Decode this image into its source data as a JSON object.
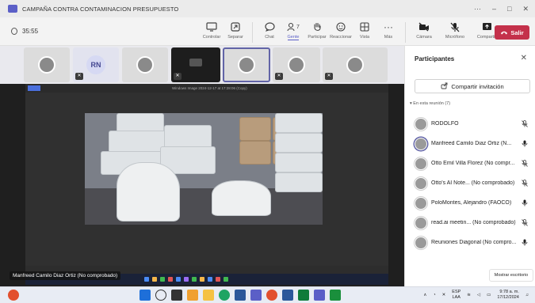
{
  "window": {
    "title": "CAMPAÑA CONTRA CONTAMINACION PRESUPUESTO",
    "controls": [
      "···",
      "–",
      "□",
      "✕"
    ]
  },
  "meeting": {
    "elapsed": "35:55",
    "tools": [
      {
        "label": "Controlar",
        "icon": "control-icon"
      },
      {
        "label": "Separar",
        "icon": "popout-icon"
      },
      {
        "label": "Chat",
        "icon": "chat-icon"
      },
      {
        "label": "Gente",
        "icon": "people-icon",
        "count": "7",
        "active": true
      },
      {
        "label": "Participar",
        "icon": "raise-hand-icon"
      },
      {
        "label": "Reaccionar",
        "icon": "react-icon"
      },
      {
        "label": "Vista",
        "icon": "view-icon"
      },
      {
        "label": "Más",
        "icon": "more-icon"
      }
    ],
    "devices": [
      {
        "label": "Cámara",
        "icon": "camera-off-icon"
      },
      {
        "label": "Micrófono",
        "icon": "mic-off-icon"
      },
      {
        "label": "Compartir",
        "icon": "share-icon"
      }
    ],
    "leave_label": "Salir"
  },
  "strip": {
    "initials": "RN"
  },
  "share": {
    "caption": "Windows Image 2024-12-17 at 17:28:06 (Copy)",
    "presenter_label": "Manfreed Camilo Diaz Ortiz (No comprobado)"
  },
  "panel": {
    "title": "Participantes",
    "invite_label": "Compartir invitación",
    "section_label": "▾ En esta reunión (7)",
    "participants": [
      {
        "name": "RODOLFO",
        "mic": "muted"
      },
      {
        "name": "Manfreed Camilo Diaz Ortiz (N...",
        "mic": "on"
      },
      {
        "name": "Otto Emil Villa Florez (No compr...",
        "mic": "muted"
      },
      {
        "name": "Otto's AI Note... (No comprobado)",
        "mic": "muted"
      },
      {
        "name": "PoloMontes, Alejandro (FAOCO)",
        "mic": "on"
      },
      {
        "name": "read.ai meetin... (No comprobado)",
        "mic": "muted"
      },
      {
        "name": "Reuniones Diagonal (No compro...",
        "mic": "on"
      }
    ],
    "desktop_button": "Mostrar escritorio"
  },
  "taskbar": {
    "lang_top": "ESP",
    "lang_bottom": "LAA",
    "time": "9:78 a. m.",
    "date": "17/12/2024"
  },
  "colors": {
    "accent": "#5b5fc7",
    "leave": "#c4314b"
  }
}
